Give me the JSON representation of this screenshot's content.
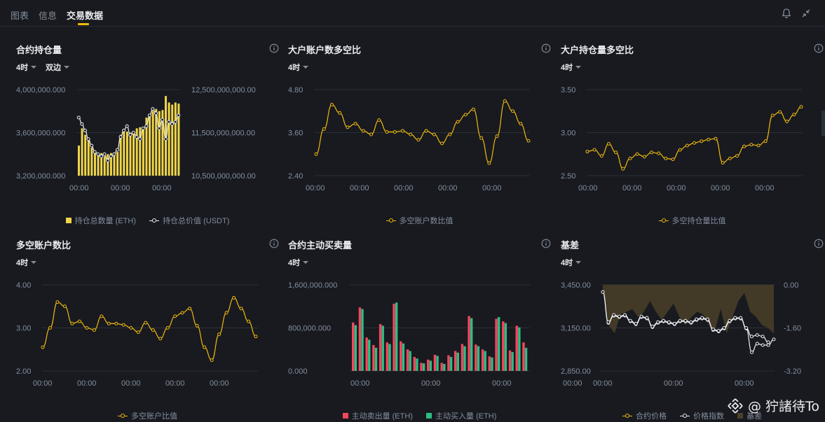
{
  "tabs": [
    {
      "label": "图表",
      "active": false
    },
    {
      "label": "信息",
      "active": false
    },
    {
      "label": "交易数据",
      "active": true
    }
  ],
  "icons": {
    "bell": "bell-icon",
    "collapse": "collapse-arrows-icon",
    "info": "info-circle-icon"
  },
  "colors": {
    "accent": "#f0b90b",
    "sell": "#f6465d",
    "buy": "#2ebd85",
    "line_white": "#eaecef",
    "muted": "#848e9c",
    "bg": "#181a20"
  },
  "panels": {
    "p1": {
      "title": "合约持仓量",
      "period": "4时",
      "side": "双边",
      "legend": [
        "持仓总数量 (ETH)",
        "持仓总价值 (USDT)"
      ]
    },
    "p2": {
      "title": "大户账户数多空比",
      "period": "4时",
      "legend": [
        "多空账户数比值"
      ]
    },
    "p3": {
      "title": "大户持仓量多空比",
      "period": "4时",
      "legend": [
        "多空持仓量比值"
      ]
    },
    "p4": {
      "title": "多空账户数比",
      "period": "4时",
      "legend": [
        "多空账户比值"
      ]
    },
    "p5": {
      "title": "合约主动买卖量",
      "period": "4时",
      "legend": [
        "主动卖出量 (ETH)",
        "主动买入量 (ETH)"
      ]
    },
    "p6": {
      "title": "基差",
      "period": "4时",
      "legend": [
        "合约价格",
        "价格指数",
        "基差"
      ]
    }
  },
  "chart_data": [
    {
      "id": "p1",
      "type": "bar",
      "title": "合约持仓量",
      "x_ticks": [
        "00:00",
        "00:00",
        "00:00"
      ],
      "y_left_ticks": [
        "4,000,000.000",
        "3,600,000.000",
        "3,200,000.000"
      ],
      "y_right_ticks": [
        "12,500,000,000.00",
        "11,500,000,000.00",
        "10,500,000,000.00"
      ],
      "ylim_left": [
        3200000,
        4000000
      ],
      "ylim_right": [
        10500000000,
        12500000000
      ],
      "series": [
        {
          "name": "持仓总数量 (ETH)",
          "type": "bar",
          "values": [
            3480000,
            3640000,
            3580000,
            3540000,
            3460000,
            3420000,
            3400000,
            3410000,
            3380000,
            3400000,
            3410000,
            3400000,
            3420000,
            3580000,
            3620000,
            3610000,
            3600000,
            3610000,
            3640000,
            3650000,
            3650000,
            3740000,
            3770000,
            3800000,
            3820000,
            3800000,
            3810000,
            3940000,
            3880000,
            3860000,
            3880000,
            3870000
          ]
        },
        {
          "name": "持仓总价值 (USDT)",
          "type": "line",
          "values": [
            11850000000,
            11700000000,
            11550000000,
            11350000000,
            11200000000,
            11050000000,
            11000000000,
            10950000000,
            11000000000,
            10850000000,
            10950000000,
            11000000000,
            11100000000,
            11400000000,
            11550000000,
            11650000000,
            11450000000,
            11500000000,
            11400000000,
            11350000000,
            11600000000,
            11650000000,
            11900000000,
            12050000000,
            11950000000,
            11600000000,
            11800000000,
            11350000000,
            11750000000,
            11700000000,
            11750000000,
            11900000000
          ]
        }
      ]
    },
    {
      "id": "p2",
      "type": "line",
      "title": "大户账户数多空比",
      "x_ticks": [
        "00:00",
        "00:00",
        "00:00",
        "00:00",
        "00:00"
      ],
      "y_ticks": [
        "4.80",
        "3.60",
        "2.40"
      ],
      "ylim": [
        2.4,
        4.8
      ],
      "series": [
        {
          "name": "多空账户数比值",
          "values": [
            3.0,
            3.7,
            4.38,
            4.15,
            3.75,
            3.85,
            3.65,
            3.55,
            3.95,
            3.62,
            3.62,
            3.65,
            3.55,
            3.4,
            3.65,
            3.55,
            3.3,
            3.55,
            3.9,
            4.1,
            4.25,
            3.45,
            2.75,
            3.5,
            4.48,
            4.2,
            3.85,
            3.37
          ]
        }
      ]
    },
    {
      "id": "p3",
      "type": "line",
      "title": "大户持仓量多空比",
      "x_ticks": [
        "00:00",
        "00:00",
        "00:00",
        "00:00",
        "00:00"
      ],
      "y_ticks": [
        "3.50",
        "3.00",
        "2.50"
      ],
      "ylim": [
        2.5,
        3.5
      ],
      "series": [
        {
          "name": "多空持仓量比值",
          "values": [
            2.78,
            2.8,
            2.73,
            2.87,
            2.77,
            2.58,
            2.7,
            2.75,
            2.72,
            2.77,
            2.76,
            2.7,
            2.69,
            2.8,
            2.85,
            2.88,
            2.9,
            2.92,
            2.93,
            2.65,
            2.7,
            2.73,
            2.84,
            2.86,
            2.85,
            2.9,
            3.2,
            3.24,
            3.13,
            3.21,
            3.3
          ]
        }
      ]
    },
    {
      "id": "p4",
      "type": "line",
      "title": "多空账户数比",
      "x_ticks": [
        "00:00",
        "00:00",
        "00:00",
        "00:00",
        "00:00"
      ],
      "y_ticks": [
        "4.00",
        "3.00",
        "2.00"
      ],
      "ylim": [
        2.0,
        4.0
      ],
      "series": [
        {
          "name": "多空账户比值",
          "values": [
            2.55,
            3.0,
            3.6,
            3.5,
            3.1,
            3.15,
            3.0,
            2.95,
            3.27,
            3.1,
            3.1,
            3.07,
            3.0,
            2.9,
            3.12,
            2.95,
            2.75,
            3.0,
            3.27,
            3.35,
            3.45,
            3.05,
            2.55,
            2.25,
            2.85,
            3.35,
            3.7,
            3.45,
            3.15,
            2.8
          ]
        }
      ]
    },
    {
      "id": "p5",
      "type": "bar",
      "title": "合约主动买卖量",
      "x_ticks": [
        "00:00",
        "00:00",
        "00:00",
        "00:00"
      ],
      "y_ticks": [
        "1,600,000.000",
        "800,000.000",
        "0.000"
      ],
      "ylim": [
        0,
        1600000
      ],
      "series": [
        {
          "name": "主动卖出量 (ETH)",
          "values": [
            900000,
            1180000,
            620000,
            480000,
            870000,
            530000,
            1250000,
            550000,
            400000,
            260000,
            150000,
            210000,
            300000,
            150000,
            290000,
            370000,
            500000,
            1020000,
            490000,
            400000,
            270000,
            970000,
            920000,
            380000,
            840000,
            530000
          ]
        },
        {
          "name": "主动买入量 (ETH)",
          "values": [
            850000,
            1150000,
            580000,
            430000,
            840000,
            500000,
            1270000,
            510000,
            370000,
            230000,
            140000,
            190000,
            280000,
            130000,
            260000,
            340000,
            460000,
            980000,
            460000,
            370000,
            250000,
            1000000,
            890000,
            350000,
            810000,
            430000
          ]
        }
      ]
    },
    {
      "id": "p6",
      "type": "line",
      "title": "基差",
      "x_ticks": [
        "00:00",
        "00:00",
        "00:00"
      ],
      "y_left_ticks": [
        "3,450.00",
        "3,150.00",
        "2,850.00"
      ],
      "y_right_ticks": [
        "0.00",
        "-1.60",
        "-3.20"
      ],
      "ylim_left": [
        2850,
        3450
      ],
      "ylim_right": [
        -3.2,
        0
      ],
      "series": [
        {
          "name": "合约价格",
          "values": [
            3400,
            3190,
            3240,
            3230,
            3240,
            3200,
            3180,
            3230,
            3220,
            3160,
            3190,
            3200,
            3190,
            3180,
            3200,
            3200,
            3190,
            3210,
            3220,
            3210,
            3140,
            3130,
            3150,
            3200,
            3220,
            3220,
            3150,
            3090,
            3100,
            3090,
            3050
          ]
        },
        {
          "name": "价格指数",
          "values": [
            3400,
            3185,
            3235,
            3225,
            3235,
            3195,
            3175,
            3225,
            3215,
            3155,
            3185,
            3195,
            3185,
            3175,
            3195,
            3195,
            3185,
            3205,
            3215,
            3205,
            3135,
            3125,
            3145,
            3195,
            3215,
            3215,
            3145,
            2980,
            3040,
            3030,
            3030,
            3070
          ]
        },
        {
          "name": "基差",
          "type": "area",
          "values": [
            -0.2,
            -1.5,
            -1.8,
            -1.1,
            -1.0,
            -0.9,
            -1.2,
            -1.0,
            -0.6,
            -1.0,
            -1.3,
            -1.0,
            -0.7,
            -1.2,
            -1.5,
            -1.2,
            -1.0,
            -1.1,
            -1.5,
            -1.7,
            -0.9,
            -1.8,
            -1.2,
            -0.6,
            -0.3,
            -1.0,
            -1.2,
            -1.5,
            -1.6,
            -1.8
          ]
        }
      ]
    }
  ],
  "watermark": "@ 狞諸待To"
}
